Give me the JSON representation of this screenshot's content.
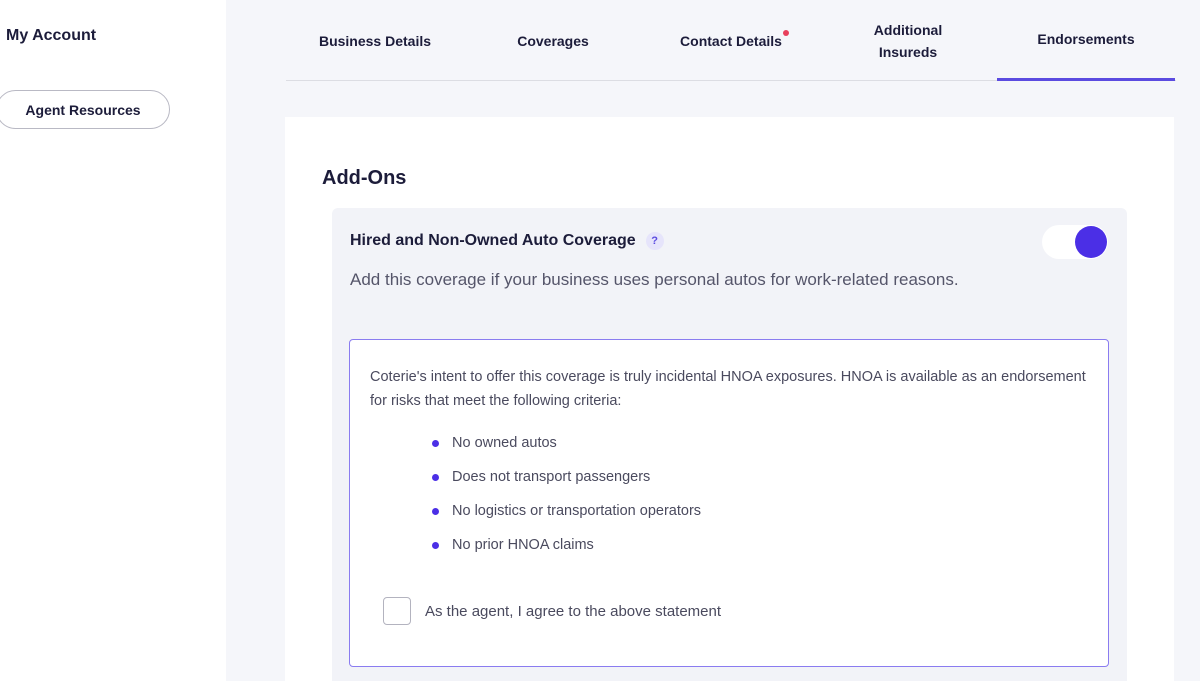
{
  "sidebar": {
    "my_account": "My Account",
    "agent_resources": "Agent Resources"
  },
  "tabs": [
    {
      "label": "Business Details",
      "active": false,
      "alert": false
    },
    {
      "label": "Coverages",
      "active": false,
      "alert": false
    },
    {
      "label": "Contact Details",
      "active": false,
      "alert": true
    },
    {
      "label": "Additional Insureds",
      "line1": "Additional",
      "line2": "Insureds",
      "active": false,
      "alert": false
    },
    {
      "label": "Endorsements",
      "active": true,
      "alert": false
    }
  ],
  "addons": {
    "title": "Add-Ons",
    "coverage": {
      "title": "Hired and Non-Owned Auto Coverage",
      "help_icon": "?",
      "description": "Add this coverage if your business uses personal autos for work-related reasons.",
      "enabled": true
    },
    "statement": {
      "text": "Coterie's intent to offer this coverage is truly incidental HNOA exposures. HNOA is available as an endorsement for risks that meet the following criteria:",
      "criteria": [
        "No owned autos",
        "Does not transport passengers",
        "No logistics or transportation operators",
        "No prior HNOA claims"
      ],
      "agree_label": "As the agent, I agree to the above statement",
      "agreed": false
    }
  },
  "colors": {
    "accent": "#4b2fe6",
    "tab_underline": "#5b4be0",
    "alert_dot": "#e8405c",
    "panel_bg": "#f2f3f8",
    "main_bg": "#f5f6fa"
  }
}
